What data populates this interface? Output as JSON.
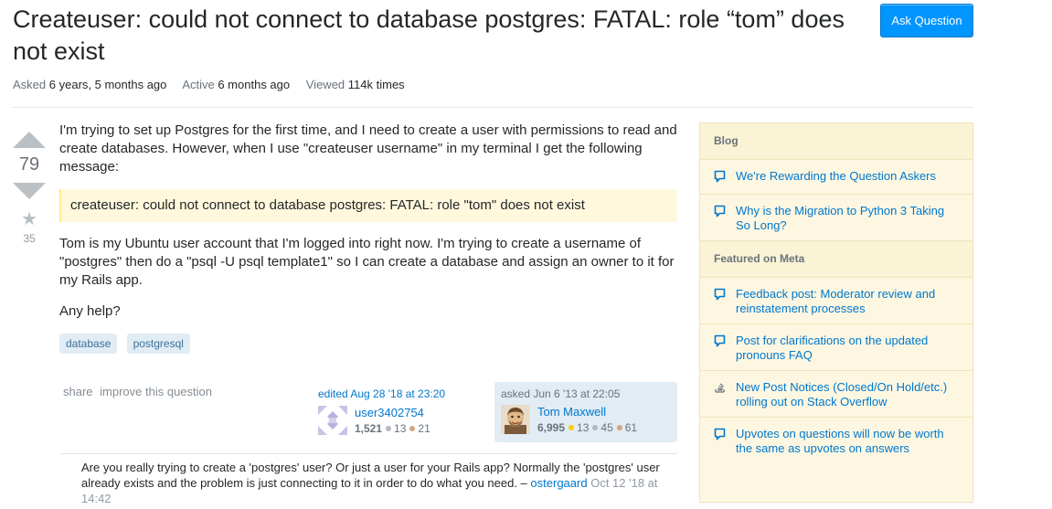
{
  "question": {
    "title": "Createuser: could not connect to database postgres: FATAL: role “tom” does not exist",
    "ask_button": "Ask Question",
    "meta": {
      "asked_label": "Asked",
      "asked_value": "6 years, 5 months ago",
      "active_label": "Active",
      "active_value": "6 months ago",
      "viewed_label": "Viewed",
      "viewed_value": "114k times"
    },
    "votes": "79",
    "favorites": "35",
    "body": {
      "p1": "I'm trying to set up Postgres for the first time, and I need to create a user with permissions to read and create databases. However, when I use \"createuser username\" in my terminal I get the following message:",
      "quote": "createuser: could not connect to database postgres: FATAL: role \"tom\" does not exist",
      "p2": "Tom is my Ubuntu user account that I'm logged into right now. I'm trying to create a username of \"postgres\" then do a \"psql -U psql template1\" so I can create a database and assign an owner to it for my Rails app.",
      "p3": "Any help?"
    },
    "tags": [
      "database",
      "postgresql"
    ],
    "menu": {
      "share": "share",
      "improve": "improve this question"
    },
    "editor": {
      "action": "edited Aug 28 '18 at 23:20",
      "name": "user3402754",
      "rep": "1,521",
      "silver": "13",
      "bronze": "21"
    },
    "owner": {
      "action": "asked Jun 6 '13 at 22:05",
      "name": "Tom Maxwell",
      "rep": "6,995",
      "gold": "13",
      "silver": "45",
      "bronze": "61"
    }
  },
  "comment": {
    "text": "Are you really trying to create a 'postgres' user? Or just a user for your Rails app? Normally the 'postgres' user already exists and the problem is just connecting to it in order to do what you need. –",
    "user": "ostergaard",
    "date": "Oct 12 '18 at 14:42"
  },
  "sidebar": {
    "blog_header": "Blog",
    "blog_items": [
      {
        "label": "We're Rewarding the Question Askers",
        "icon": "speech-bubble-icon"
      },
      {
        "label": "Why is the Migration to Python 3 Taking So Long?",
        "icon": "speech-bubble-icon"
      }
    ],
    "meta_header": "Featured on Meta",
    "meta_items": [
      {
        "label": "Feedback post: Moderator review and reinstatement processes",
        "icon": "speech-bubble-icon"
      },
      {
        "label": "Post for clarifications on the updated pronouns FAQ",
        "icon": "speech-bubble-icon"
      },
      {
        "label": "New Post Notices (Closed/On Hold/etc.) rolling out on Stack Overflow",
        "icon": "stack-icon"
      },
      {
        "label": "Upvotes on questions will now be worth the same as upvotes on answers",
        "icon": "speech-bubble-icon"
      }
    ]
  },
  "colors": {
    "accent": "#0077cc",
    "button": "#0095ff",
    "sidebar_bg": "#fdf7e2",
    "quote_bg": "#fff8dc",
    "tag_bg": "#e1ecf4"
  }
}
